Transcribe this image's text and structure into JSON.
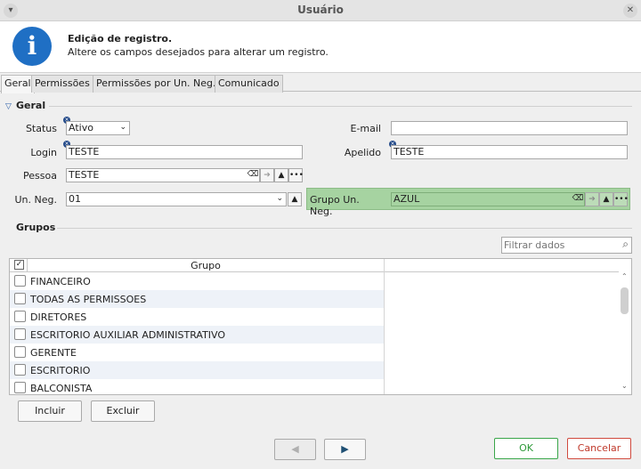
{
  "window": {
    "title": "Usuário"
  },
  "header": {
    "title": "Edição de registro.",
    "subtitle": "Altere os campos desejados para alterar um registro."
  },
  "tabs": [
    "Geral",
    "Permissões",
    "Permissões por Un. Neg.",
    "Comunicado"
  ],
  "section_general": "Geral",
  "fields": {
    "status_label": "Status",
    "status_value": "Ativo",
    "email_label": "E-mail",
    "email_value": "",
    "login_label": "Login",
    "login_value": "TESTE",
    "apelido_label": "Apelido",
    "apelido_value": "TESTE",
    "pessoa_label": "Pessoa",
    "pessoa_value": "TESTE",
    "unneg_label": "Un. Neg.",
    "unneg_value": "01",
    "grupo_unneg_label": "Grupo Un. Neg.",
    "grupo_unneg_value": "AZUL"
  },
  "section_groups": "Grupos",
  "filter_placeholder": "Filtrar dados",
  "grid": {
    "header": "Grupo",
    "rows": [
      "FINANCEIRO",
      "TODAS AS PERMISSOES",
      "DIRETORES",
      "ESCRITORIO AUXILIAR ADMINISTRATIVO",
      "GERENTE",
      "ESCRITORIO",
      "BALCONISTA"
    ]
  },
  "buttons": {
    "include": "Incluir",
    "exclude": "Excluir",
    "ok": "OK",
    "cancel": "Cancelar"
  },
  "colors": {
    "accent_green": "#2e9a3a",
    "cancel_red": "#c0392b",
    "highlight": "#a6d3a1"
  }
}
